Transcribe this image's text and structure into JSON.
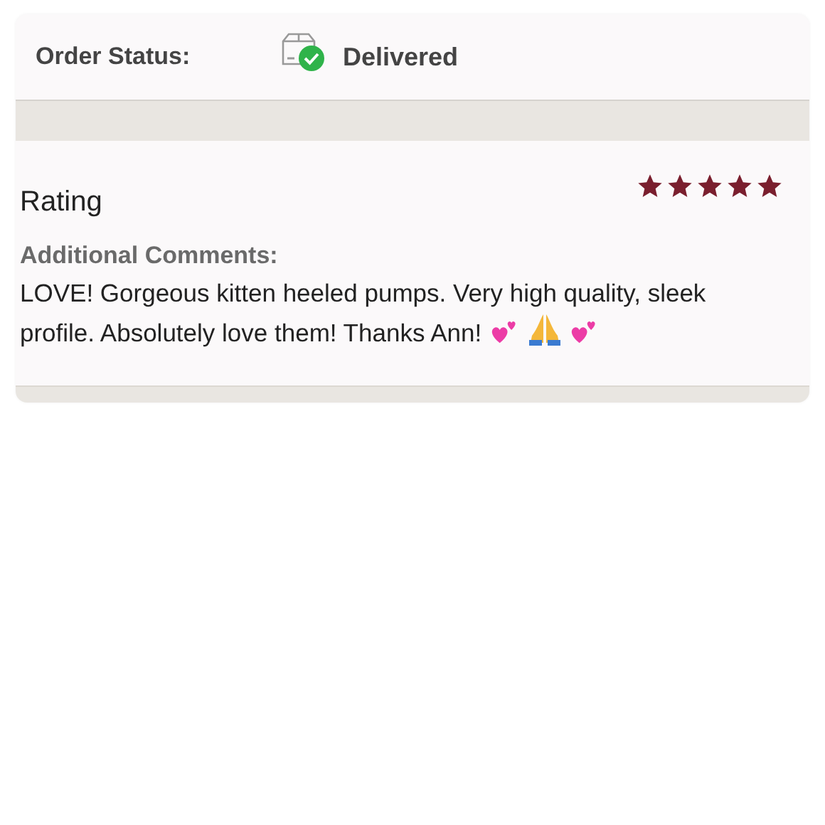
{
  "order_status": {
    "label": "Order Status:",
    "value": "Delivered",
    "kind": "delivered"
  },
  "rating": {
    "label": "Rating",
    "stars": 5
  },
  "comments": {
    "label": "Additional Comments:",
    "lines": [
      "LOVE! Gorgeous kitten heeled pumps. Very high quality, sleek",
      "profile. Absolutely love them! Thanks Ann!"
    ]
  }
}
